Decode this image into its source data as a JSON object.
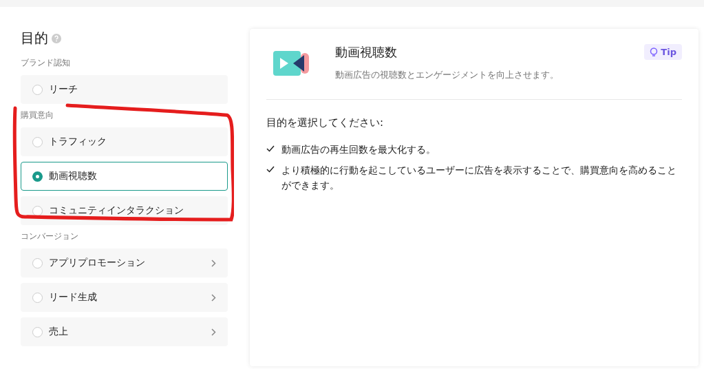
{
  "heading": "目的",
  "groups": [
    {
      "label": "ブランド認知",
      "circled": false,
      "items": [
        {
          "label": "リーチ",
          "selected": false,
          "has_submenu": false
        }
      ]
    },
    {
      "label": "購買意向",
      "circled": true,
      "items": [
        {
          "label": "トラフィック",
          "selected": false,
          "has_submenu": false
        },
        {
          "label": "動画視聴数",
          "selected": true,
          "has_submenu": false
        },
        {
          "label": "コミュニティインタラクション",
          "selected": false,
          "has_submenu": false
        }
      ]
    },
    {
      "label": "コンバージョン",
      "circled": false,
      "items": [
        {
          "label": "アプリプロモーション",
          "selected": false,
          "has_submenu": true
        },
        {
          "label": "リード生成",
          "selected": false,
          "has_submenu": true
        },
        {
          "label": "売上",
          "selected": false,
          "has_submenu": true
        }
      ]
    }
  ],
  "detail": {
    "title": "動画視聴数",
    "description": "動画広告の視聴数とエンゲージメントを向上させます。",
    "tip": "Tip",
    "prompt": "目的を選択してください:",
    "points": [
      "動画広告の再生回数を最大化する。",
      "より積極的に行動を起こしているユーザーに広告を表示することで、購買意向を高めることができます。"
    ]
  }
}
